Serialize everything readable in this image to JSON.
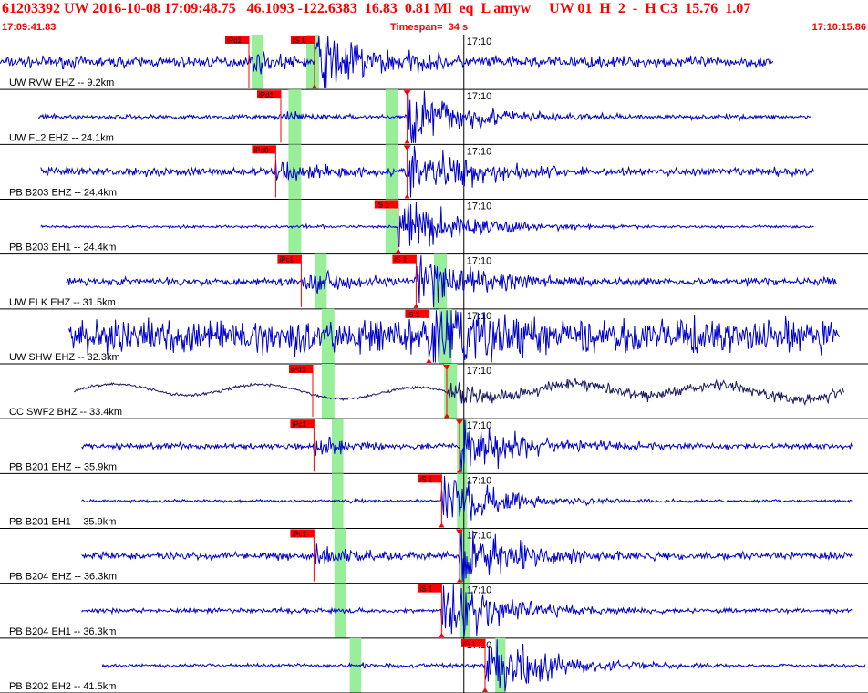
{
  "header": {
    "event_id": "61203392",
    "network": "UW",
    "datetime": "2016-10-08 17:09:48.75",
    "lat": "46.1093",
    "lon": "-122.6383",
    "depth": "16.83",
    "magnitude": "0.81 Ml",
    "event_type": "eq",
    "flag": "L",
    "author": "amyw",
    "solution": "UW 01",
    "quality": "H",
    "count": "2",
    "dash": "-",
    "quality2": "H C3",
    "val1": "15.76",
    "val2": "1.07"
  },
  "time_bar": {
    "start": "17:09:41.83",
    "timespan": "Timespan=  34 s",
    "end": "17:10:15.86"
  },
  "colors": {
    "trace": "#0000cc",
    "trace_dark": "#1a1a66",
    "pick": "#ff0000",
    "window": "#99ee99",
    "divider": "#000000"
  },
  "chart_data": {
    "type": "line",
    "x_range_s": [
      0,
      34
    ],
    "minute_marker": {
      "label": "17:10",
      "time_s": 18.17
    },
    "traces": [
      {
        "label": "UW RVW EHZ -- 9.2km",
        "start_s": 0.0,
        "end_s": 30.3,
        "p_label": "iPd1",
        "p_s": 9.75,
        "s_label": "iS 1",
        "s_s": 12.32,
        "p_win_s": [
          9.85,
          10.3
        ],
        "s_win_s": [
          12.0,
          12.5
        ],
        "amp": 0.12,
        "p_amp": 0.25,
        "s_amp": 0.75,
        "dark": false
      },
      {
        "label": "UW FL2 EHZ -- 24.1km",
        "start_s": 1.5,
        "end_s": 31.8,
        "p_label": "iPd1",
        "p_s": 11.0,
        "s_label": "",
        "s_s": 15.95,
        "p_win_s": [
          11.3,
          11.8
        ],
        "s_win_s": [
          15.1,
          15.6
        ],
        "amp": 0.05,
        "p_amp": 0.12,
        "s_amp": 0.75,
        "dark": false
      },
      {
        "label": "PB B203 EHZ -- 24.4km",
        "start_s": 1.6,
        "end_s": 31.9,
        "p_label": "iPd0",
        "p_s": 10.8,
        "s_label": "",
        "s_s": 15.95,
        "p_win_s": [
          11.3,
          11.8
        ],
        "s_win_s": [
          15.1,
          15.6
        ],
        "amp": 0.09,
        "p_amp": 0.3,
        "s_amp": 0.7,
        "dark": false
      },
      {
        "label": "PB B203 EH1 -- 24.4km",
        "start_s": 1.6,
        "end_s": 31.9,
        "p_label": "",
        "p_s": 11.8,
        "s_label": "iS 1",
        "s_s": 15.6,
        "p_win_s": [
          11.3,
          11.8
        ],
        "s_win_s": [
          15.1,
          15.6
        ],
        "amp": 0.03,
        "p_amp": 0.05,
        "s_amp": 0.7,
        "dark": false
      },
      {
        "label": "UW ELK EHZ -- 31.5km",
        "start_s": 2.6,
        "end_s": 32.8,
        "p_label": "iPc1",
        "p_s": 11.8,
        "s_label": "iS 1",
        "s_s": 16.3,
        "p_win_s": [
          12.35,
          12.8
        ],
        "s_win_s": [
          17.0,
          17.5
        ],
        "amp": 0.08,
        "p_amp": 0.3,
        "s_amp": 0.7,
        "dark": false
      },
      {
        "label": "UW SHW EHZ -- 32.3km",
        "start_s": 2.7,
        "end_s": 32.9,
        "p_label": "",
        "p_s": 12.8,
        "s_label": "iS 1",
        "s_s": 16.8,
        "p_win_s": [
          12.6,
          13.1
        ],
        "s_win_s": [
          17.2,
          17.7
        ],
        "amp": 0.35,
        "p_amp": 0.45,
        "s_amp": 0.85,
        "dark": false
      },
      {
        "label": "CC SWF2 BHZ -- 33.4km",
        "start_s": 2.9,
        "end_s": 33.1,
        "p_label": "iPd1",
        "p_s": 12.25,
        "s_label": "",
        "s_s": 17.5,
        "p_win_s": [
          12.6,
          13.1
        ],
        "s_win_s": [
          17.4,
          17.9
        ],
        "amp": 0.2,
        "p_amp": 0.25,
        "s_amp": 0.45,
        "dark": true
      },
      {
        "label": "PB B201 EHZ -- 35.9km",
        "start_s": 3.2,
        "end_s": 33.4,
        "p_label": "iPc1",
        "p_s": 12.3,
        "s_label": "",
        "s_s": 18.0,
        "p_win_s": [
          13.0,
          13.45
        ],
        "s_win_s": [
          17.9,
          18.3
        ],
        "amp": 0.06,
        "p_amp": 0.2,
        "s_amp": 0.75,
        "dark": false
      },
      {
        "label": "PB B201 EH1 -- 35.9km",
        "start_s": 3.2,
        "end_s": 33.4,
        "p_label": "",
        "p_s": 13.45,
        "s_label": "iS 1",
        "s_s": 17.3,
        "p_win_s": [
          13.0,
          13.45
        ],
        "s_win_s": [
          17.9,
          18.3
        ],
        "amp": 0.03,
        "p_amp": 0.05,
        "s_amp": 0.7,
        "dark": false
      },
      {
        "label": "PB B204 EHZ -- 36.3km",
        "start_s": 3.2,
        "end_s": 33.4,
        "p_label": "iPc1",
        "p_s": 12.3,
        "s_label": "",
        "s_s": 18.0,
        "p_win_s": [
          13.1,
          13.55
        ],
        "s_win_s": [
          18.0,
          18.4
        ],
        "amp": 0.08,
        "p_amp": 0.25,
        "s_amp": 0.7,
        "dark": false
      },
      {
        "label": "PB B204 EH1 -- 36.3km",
        "start_s": 3.2,
        "end_s": 33.4,
        "p_label": "",
        "p_s": 13.55,
        "s_label": "iS 1",
        "s_s": 17.3,
        "p_win_s": [
          13.1,
          13.55
        ],
        "s_win_s": [
          18.0,
          18.4
        ],
        "amp": 0.05,
        "p_amp": 0.07,
        "s_amp": 0.75,
        "dark": false
      },
      {
        "label": "PB B202 EH2 -- 41.5km",
        "start_s": 4.0,
        "end_s": 33.9,
        "p_label": "",
        "p_s": 14.2,
        "s_label": "iS 1",
        "s_s": 19.0,
        "p_win_s": [
          13.7,
          14.15
        ],
        "s_win_s": [
          19.4,
          19.8
        ],
        "amp": 0.04,
        "p_amp": 0.06,
        "s_amp": 0.7,
        "dark": false
      }
    ]
  }
}
